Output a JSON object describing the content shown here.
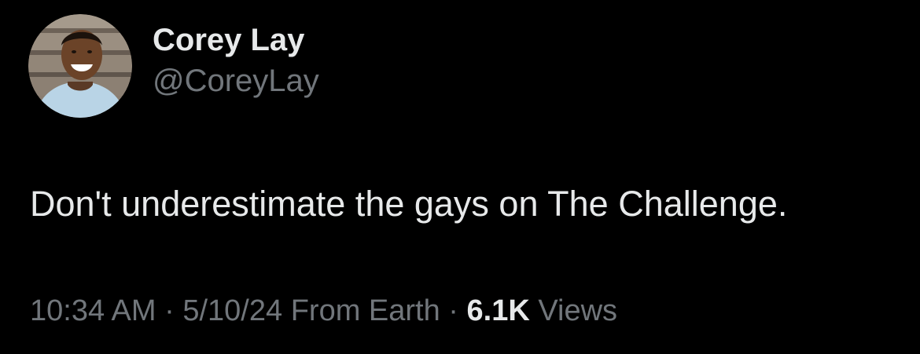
{
  "author": {
    "display_name": "Corey Lay",
    "handle": "@CoreyLay",
    "avatar_icon": "profile-photo"
  },
  "tweet": {
    "text": "Don't underestimate the gays on The Challenge."
  },
  "meta": {
    "time": "10:34 AM",
    "separator_1": " · ",
    "date": "5/10/24",
    "source": " From Earth",
    "separator_2": " · ",
    "views_count": "6.1K",
    "views_label": " Views"
  },
  "colors": {
    "background": "#000000",
    "primary_text": "#e7e9ea",
    "secondary_text": "#71767b"
  }
}
